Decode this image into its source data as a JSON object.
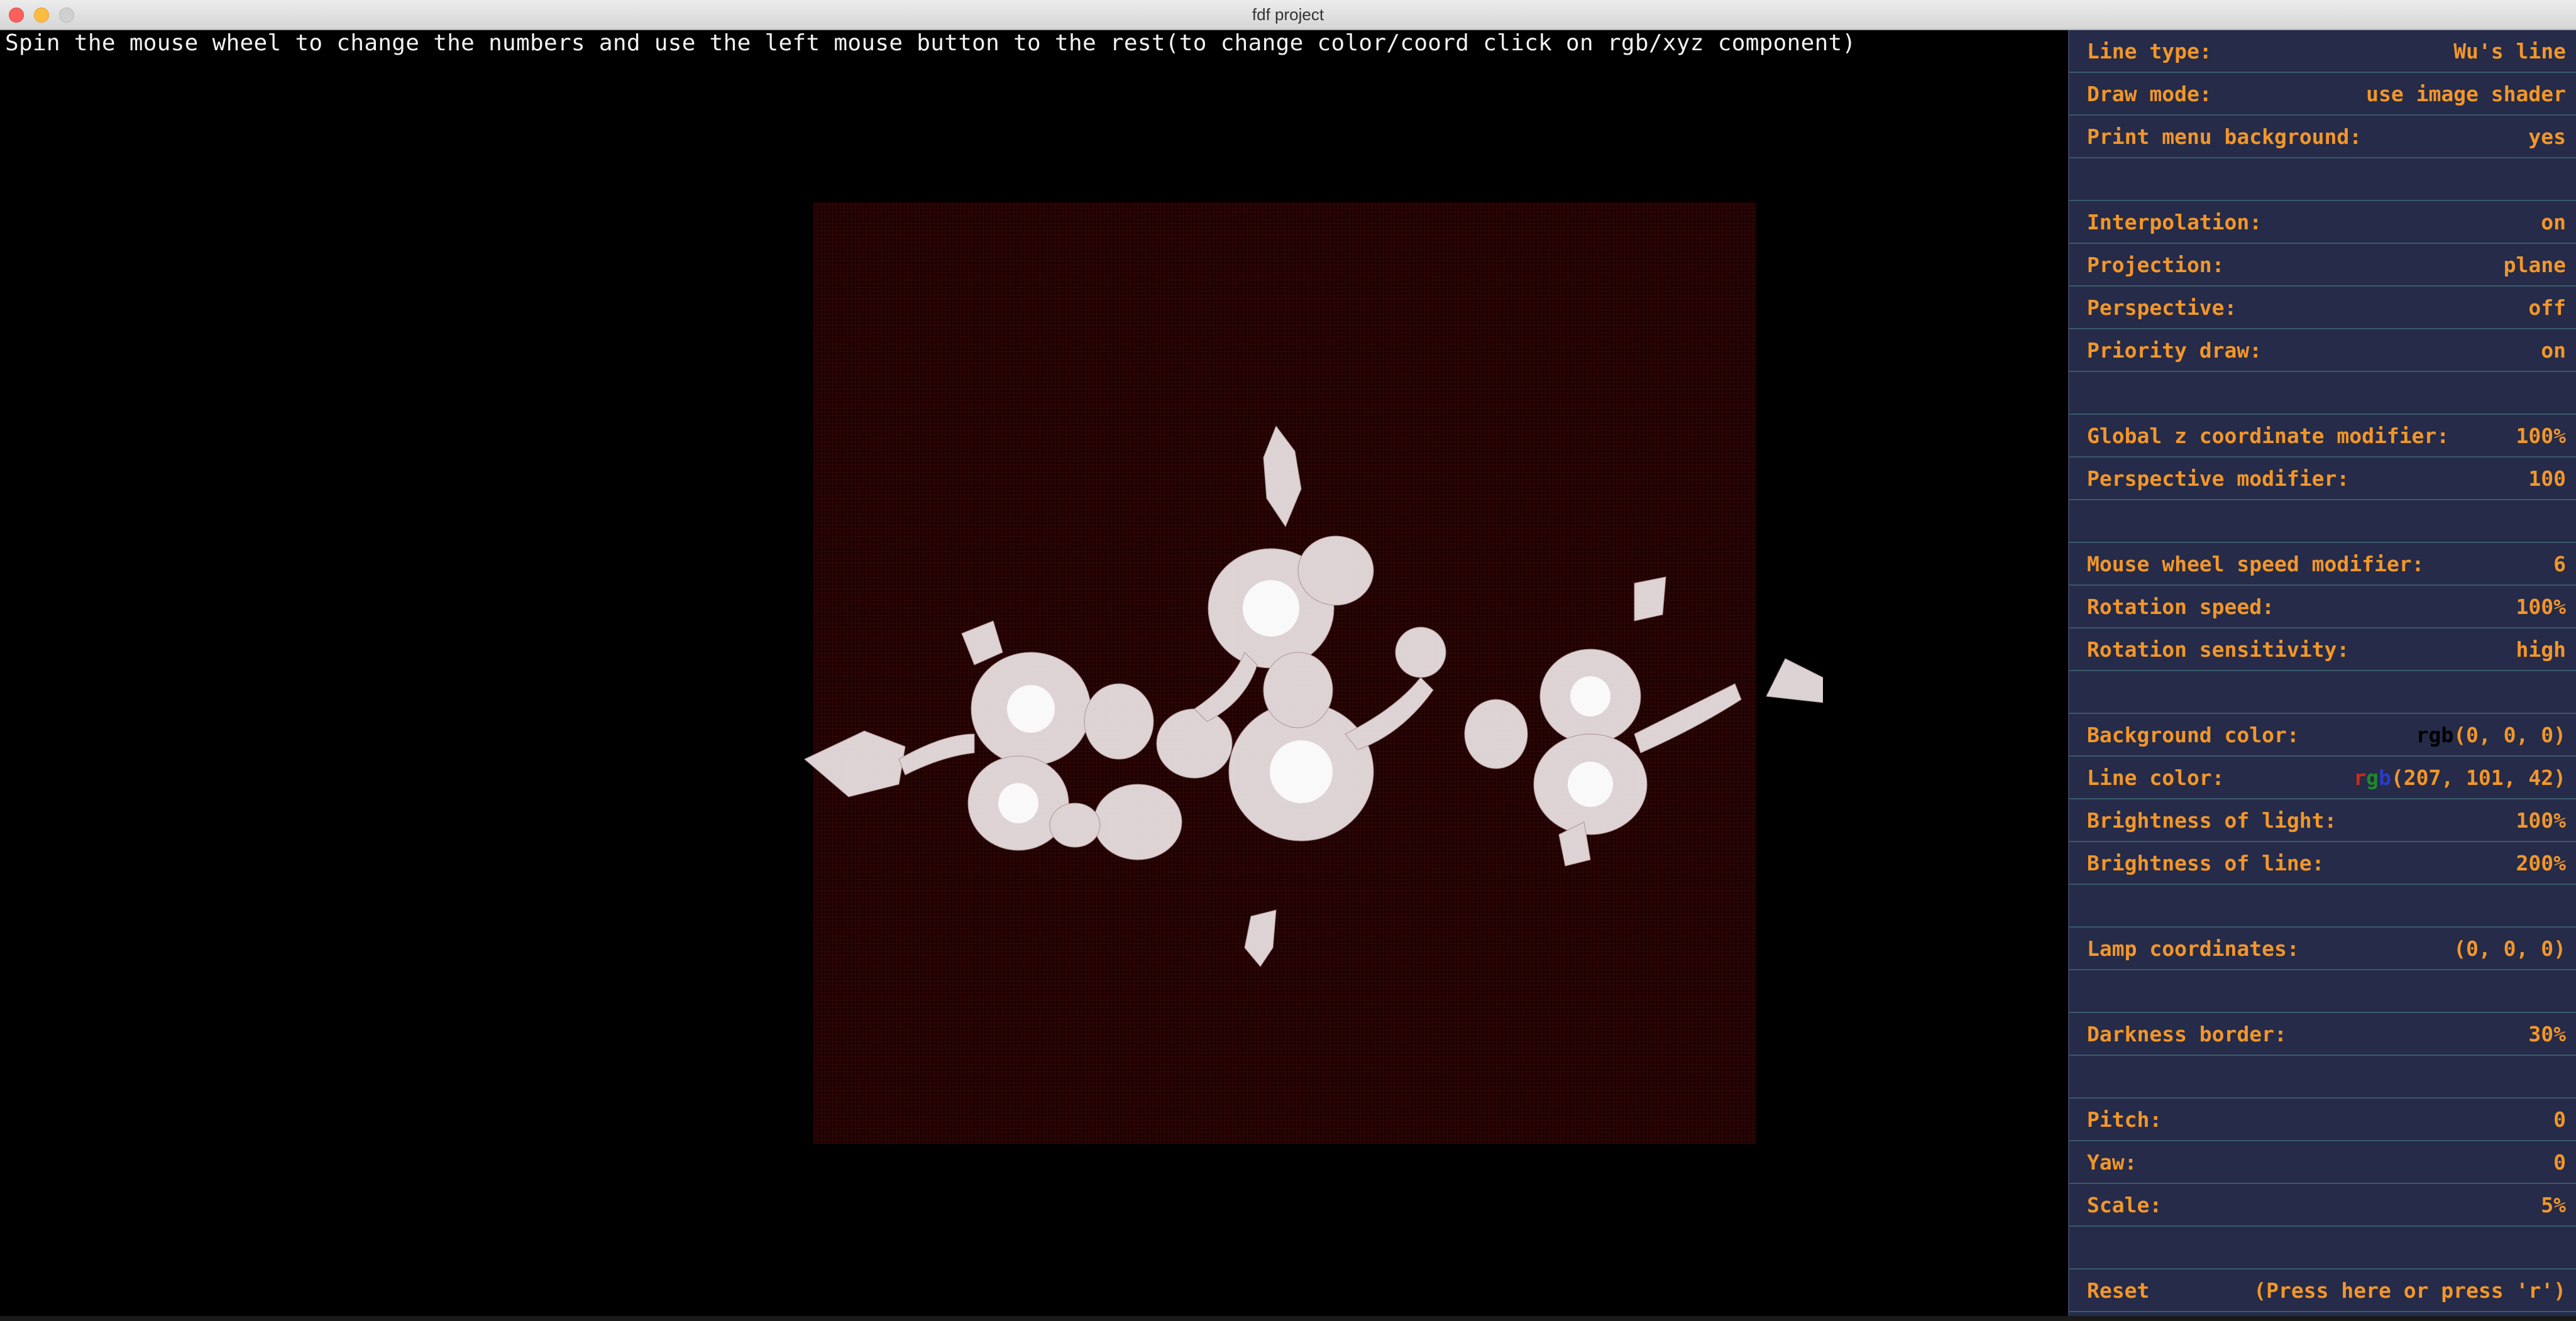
{
  "window": {
    "title": "fdf project"
  },
  "hint": "Spin the mouse wheel to change the numbers and use the left mouse button to the rest(to change color/coord click on rgb/xyz component)",
  "colors": {
    "menu_text": "#f2962a",
    "panel_bg": "#252b48",
    "render_bg": "#1f0101",
    "line_color": "#cf652a"
  },
  "menu": {
    "line_type": {
      "label": "Line type:",
      "value": "Wu's line"
    },
    "draw_mode": {
      "label": "Draw mode:",
      "value": "use image shader"
    },
    "print_menu_bg": {
      "label": "Print menu background:",
      "value": "yes"
    },
    "interpolation": {
      "label": "Interpolation:",
      "value": "on"
    },
    "projection": {
      "label": "Projection:",
      "value": "plane"
    },
    "perspective": {
      "label": "Perspective:",
      "value": "off"
    },
    "priority_draw": {
      "label": "Priority draw:",
      "value": "on"
    },
    "global_z": {
      "label": "Global z coordinate modifier:",
      "value": "100%"
    },
    "perspective_mod": {
      "label": "Perspective modifier:",
      "value": "100"
    },
    "wheel_speed": {
      "label": "Mouse wheel speed modifier:",
      "value": "6"
    },
    "rotation_speed": {
      "label": "Rotation speed:",
      "value": "100%"
    },
    "rotation_sens": {
      "label": "Rotation sensitivity:",
      "value": "high"
    },
    "bg_color": {
      "label": "Background color:",
      "c1": "r",
      "c2": "g",
      "c3": "b",
      "value": "(0, 0, 0)"
    },
    "line_color": {
      "label": "Line color:",
      "c1": "r",
      "c2": "g",
      "c3": "b",
      "value": "(207, 101, 42)"
    },
    "light_brightness": {
      "label": "Brightness of light:",
      "value": "100%"
    },
    "line_brightness": {
      "label": "Brightness of line:",
      "value": "200%"
    },
    "lamp": {
      "label": "Lamp coordinates:",
      "value": "(0, 0, 0)"
    },
    "darkness": {
      "label": "Darkness border:",
      "value": "30%"
    },
    "pitch": {
      "label": "Pitch:",
      "value": "0"
    },
    "yaw": {
      "label": "Yaw:",
      "value": "0"
    },
    "scale": {
      "label": "Scale:",
      "value": "5%"
    },
    "reset": {
      "label": "Reset",
      "value": "(Press here or press 'r')"
    }
  }
}
